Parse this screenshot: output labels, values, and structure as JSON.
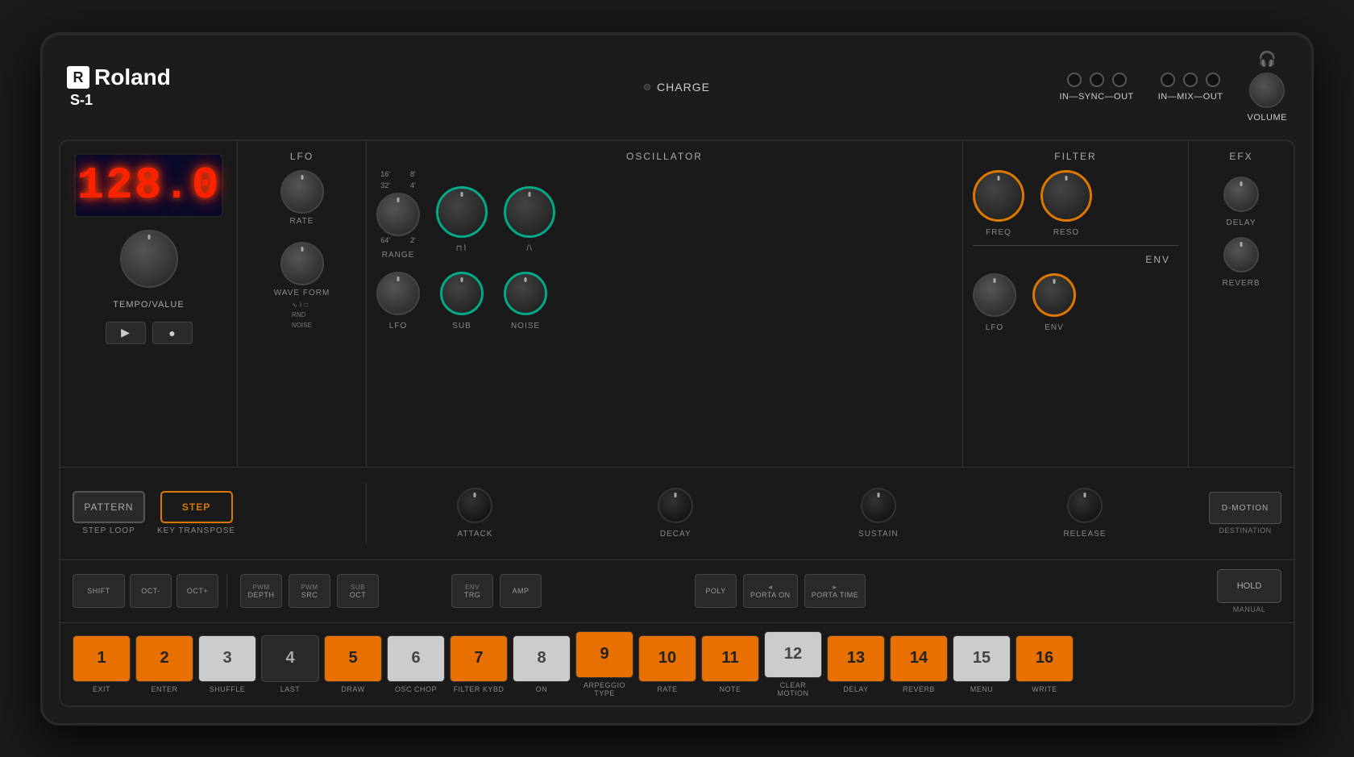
{
  "brand": {
    "logo": "Roland",
    "model": "S-1"
  },
  "top": {
    "charge_label": "CHARGE",
    "port_group1_label": "IN—SYNC—OUT",
    "port_group2_label": "IN—MIX—OUT",
    "volume_label": "VOLUME"
  },
  "display": {
    "value": "128.0"
  },
  "sections": {
    "lfo": {
      "label": "LFO",
      "rate_label": "RATE",
      "waveform_label": "WAVE FORM",
      "waveform_options": [
        "sine",
        "triangle",
        "square",
        "rnd",
        "noise"
      ]
    },
    "oscillator": {
      "label": "OSCILLATOR",
      "range_label": "RANGE",
      "range_values": [
        "16'",
        "8'",
        "32'",
        "4'",
        "64'",
        "2'"
      ],
      "lfo_label": "LFO",
      "sub_label": "SUB",
      "noise_label": "NOISE"
    },
    "filter": {
      "label": "FILTER",
      "freq_label": "FREQ",
      "reso_label": "RESO",
      "lfo_label": "LFO",
      "env_label": "ENV",
      "env_section_label": "ENV"
    },
    "efx": {
      "label": "EFX",
      "delay_label": "DELAY",
      "reverb_label": "REVERB"
    }
  },
  "middle": {
    "pattern_label": "PATTERN",
    "step_loop_label": "STEP LOOP",
    "step_label": "STEP",
    "key_transpose_label": "KEY TRANSPOSE",
    "attack_label": "ATTACK",
    "decay_label": "DECAY",
    "sustain_label": "SUSTAIN",
    "release_label": "RELEASE",
    "dmotion_label": "D-MOTION",
    "destination_label": "DESTINATION"
  },
  "func_buttons": [
    {
      "label": "SHIFT",
      "top": "",
      "wide": true
    },
    {
      "label": "OCT-",
      "top": "",
      "wide": false
    },
    {
      "label": "OCT+",
      "top": "",
      "wide": false
    },
    {
      "label": "PWM DEPTH",
      "top": "",
      "wide": false
    },
    {
      "label": "PWM SRC",
      "top": "",
      "wide": false
    },
    {
      "label": "SUB OCT",
      "top": "",
      "wide": false
    },
    {
      "label": "ENV TRG",
      "top": "",
      "wide": false
    },
    {
      "label": "AMP",
      "top": "",
      "wide": false
    },
    {
      "label": "POLY",
      "top": "",
      "wide": false
    },
    {
      "label": "PORTA ON",
      "top": "◄",
      "wide": false
    },
    {
      "label": "PORTA TIME",
      "top": "►",
      "wide": false
    },
    {
      "label": "HOLD",
      "top": "",
      "wide": true,
      "right": true
    },
    {
      "label": "MANUAL",
      "top": "",
      "sub": true
    }
  ],
  "step_buttons": [
    {
      "number": "1",
      "color": "orange",
      "label": "EXIT"
    },
    {
      "number": "2",
      "color": "orange",
      "label": "ENTER"
    },
    {
      "number": "3",
      "color": "white",
      "label": "SHUFFLE"
    },
    {
      "number": "4",
      "color": "dark",
      "label": "LAST"
    },
    {
      "number": "5",
      "color": "orange",
      "label": "DRAW"
    },
    {
      "number": "6",
      "color": "white",
      "label": "OSC CHOP"
    },
    {
      "number": "7",
      "color": "orange",
      "label": "FILTER KYBD"
    },
    {
      "number": "8",
      "color": "white",
      "label": "ON"
    },
    {
      "number": "9",
      "color": "orange",
      "label": "ARPEGGIO TYPE"
    },
    {
      "number": "10",
      "color": "orange",
      "label": "RATE"
    },
    {
      "number": "11",
      "color": "orange",
      "label": "NOTE"
    },
    {
      "number": "12",
      "color": "white",
      "label": "CLEAR MOTION"
    },
    {
      "number": "13",
      "color": "orange",
      "label": "DELAY"
    },
    {
      "number": "14",
      "color": "orange",
      "label": "REVERB"
    },
    {
      "number": "15",
      "color": "white",
      "label": "MENU"
    },
    {
      "number": "16",
      "color": "orange",
      "label": "WRITE"
    }
  ],
  "tempo_value_label": "TEMPO/VALUE"
}
